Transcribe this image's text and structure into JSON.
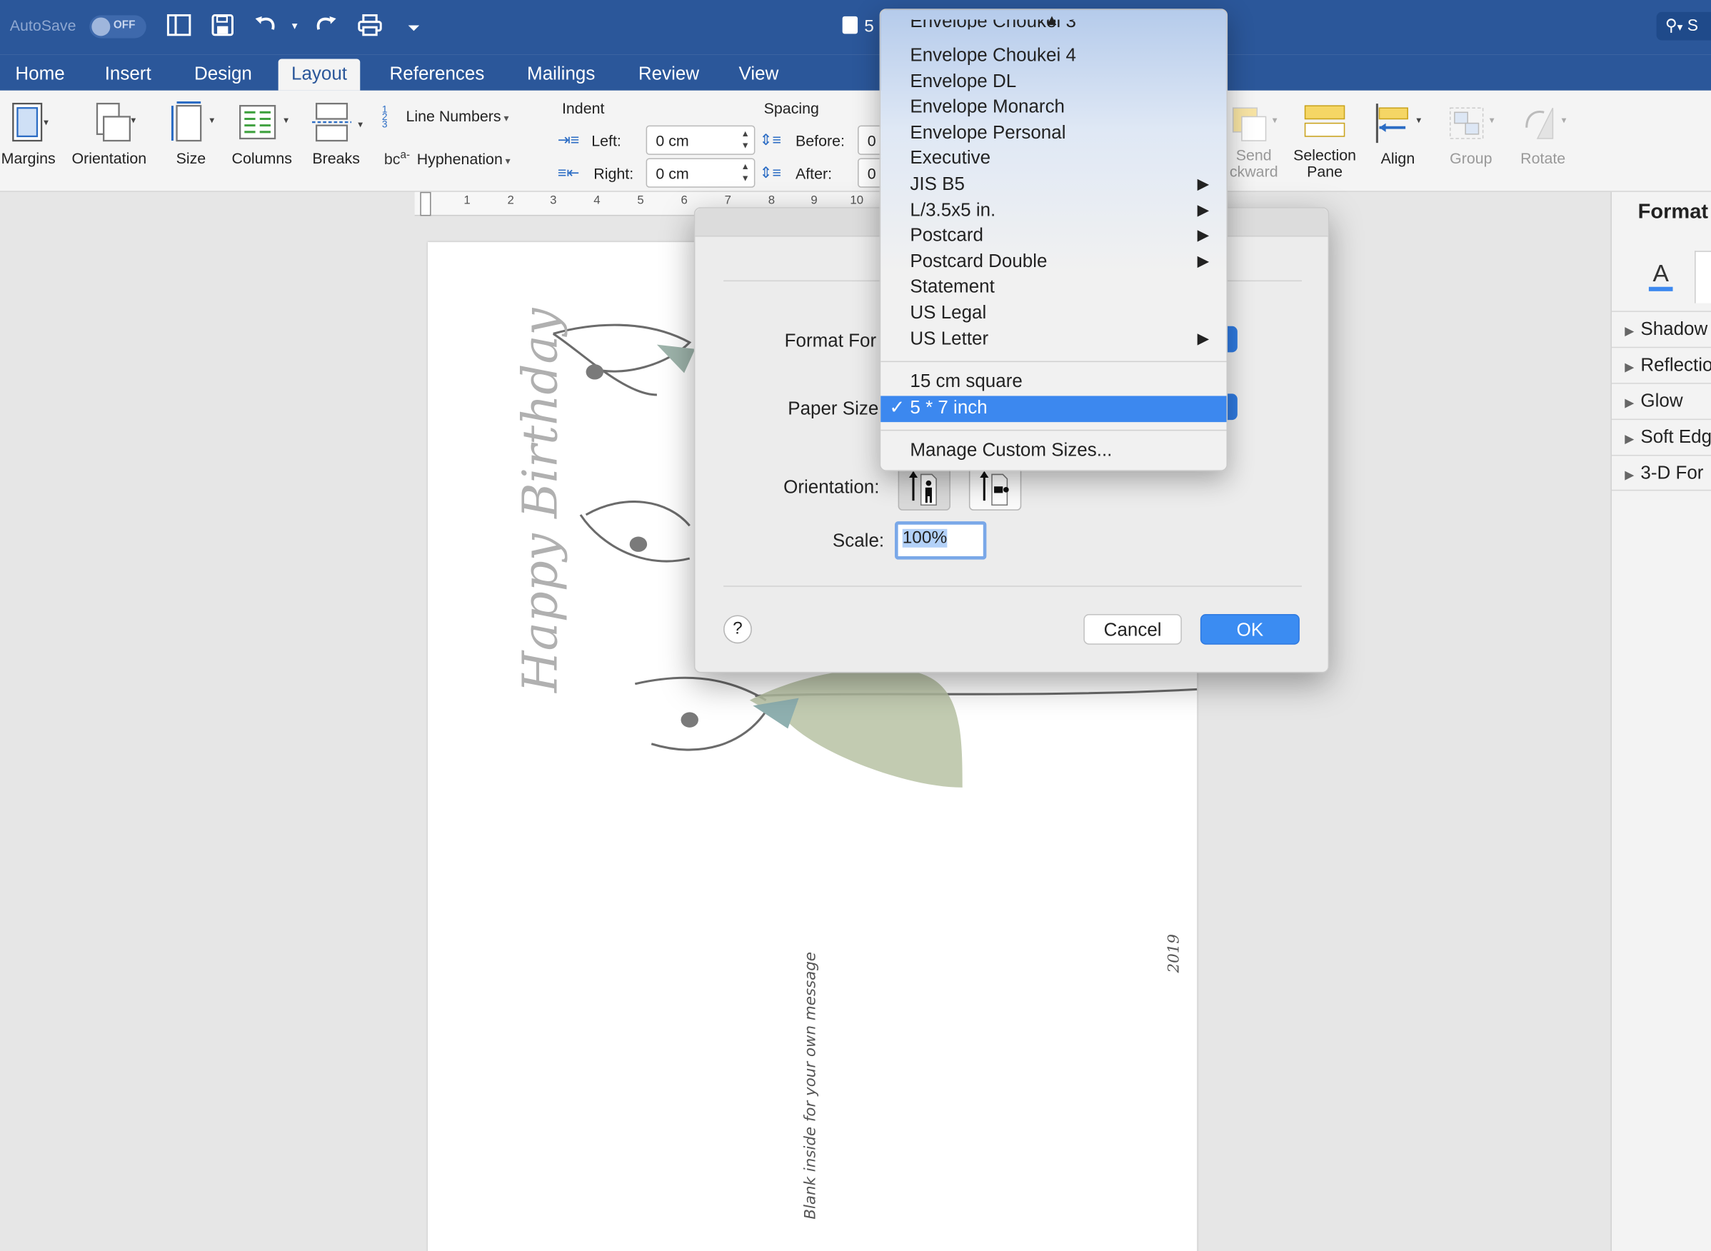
{
  "titlebar": {
    "autosave_label": "AutoSave",
    "autosave_state": "OFF",
    "doc_title": "5",
    "search_label": "S"
  },
  "tabs": [
    "Home",
    "Insert",
    "Design",
    "Layout",
    "References",
    "Mailings",
    "Review",
    "View"
  ],
  "active_tab": "Layout",
  "ribbon": {
    "margins": "Margins",
    "orientation": "Orientation",
    "size": "Size",
    "columns": "Columns",
    "breaks": "Breaks",
    "line_numbers": "Line Numbers",
    "hyphenation": "Hyphenation",
    "indent_heading": "Indent",
    "spacing_heading": "Spacing",
    "indent_left_label": "Left:",
    "indent_left_value": "0 cm",
    "indent_right_label": "Right:",
    "indent_right_value": "0 cm",
    "spacing_before_label": "Before:",
    "spacing_before_value": "0",
    "spacing_after_label": "After:",
    "spacing_after_value": "0",
    "send_backward_line1": "Send",
    "send_backward_line2": "ckward",
    "selection_pane_line1": "Selection",
    "selection_pane_line2": "Pane",
    "align": "Align",
    "group": "Group",
    "rotate": "Rotate"
  },
  "ruler_numbers": [
    "1",
    "2",
    "3",
    "4",
    "5",
    "6",
    "7",
    "8",
    "9",
    "10"
  ],
  "document": {
    "greeting": "Happy Birthday",
    "inside_note": "Blank inside for your own message",
    "year": "2019"
  },
  "format_pane": {
    "title": "Format",
    "items": [
      "Shadow",
      "Reflectio",
      "Glow",
      "Soft Edg",
      "3-D For"
    ]
  },
  "dialog": {
    "format_for_label": "Format For",
    "paper_size_label": "Paper Size",
    "orientation_label": "Orientation:",
    "scale_label": "Scale:",
    "scale_value": "100%",
    "help": "?",
    "cancel": "Cancel",
    "ok": "OK"
  },
  "paper_menu": {
    "cut_off_item": "Envelope Choukei 3",
    "items": [
      {
        "label": "Envelope Choukei 4",
        "submenu": false
      },
      {
        "label": "Envelope DL",
        "submenu": false
      },
      {
        "label": "Envelope Monarch",
        "submenu": false
      },
      {
        "label": "Envelope Personal",
        "submenu": false
      },
      {
        "label": "Executive",
        "submenu": false
      },
      {
        "label": "JIS B5",
        "submenu": true
      },
      {
        "label": "L/3.5x5 in.",
        "submenu": true
      },
      {
        "label": "Postcard",
        "submenu": true
      },
      {
        "label": "Postcard Double",
        "submenu": true
      },
      {
        "label": "Statement",
        "submenu": false
      },
      {
        "label": "US Legal",
        "submenu": false
      },
      {
        "label": "US Letter",
        "submenu": true
      }
    ],
    "custom_items": [
      "15 cm square",
      "5 * 7 inch"
    ],
    "selected": "5 * 7 inch",
    "manage": "Manage Custom Sizes..."
  },
  "colors": {
    "word_blue": "#2b579a",
    "selection_blue": "#3c88ef",
    "ok_blue": "#3b8cf2"
  }
}
